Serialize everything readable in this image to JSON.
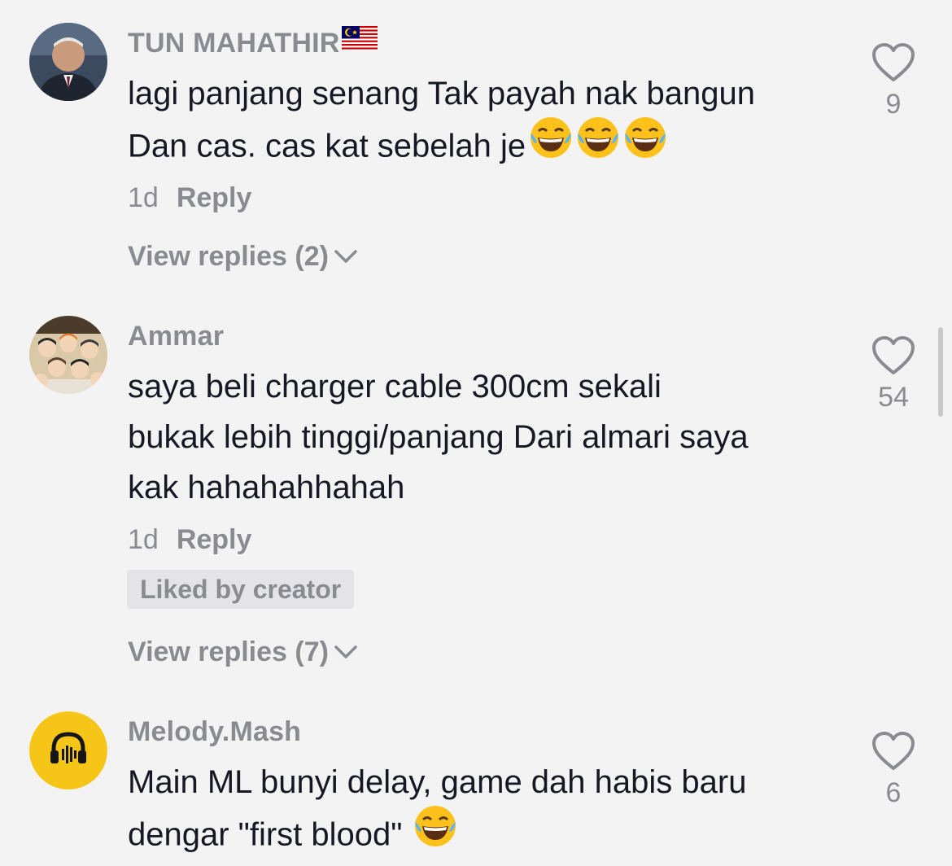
{
  "comments": [
    {
      "username": "TUN MAHATHIR",
      "username_flag": "malaysia-flag",
      "text": "lagi panjang senang Tak payah nak bangun\nDan cas. cas kat sebelah je",
      "text_emojis": [
        "face-with-tears-of-joy",
        "face-with-tears-of-joy",
        "face-with-tears-of-joy"
      ],
      "time": "1d",
      "reply_label": "Reply",
      "view_replies": "View replies (2)",
      "like_count": "9",
      "avatar": "portrait-avatar"
    },
    {
      "username": "Ammar",
      "text": "saya beli charger cable 300cm sekali\nbukak lebih tinggi/panjang Dari almari saya\nkak hahahahhahah",
      "time": "1d",
      "reply_label": "Reply",
      "badge": "Liked by creator",
      "view_replies": "View replies (7)",
      "like_count": "54",
      "avatar": "anime-group-avatar"
    },
    {
      "username": "Melody.Mash",
      "text": "Main ML bunyi delay, game dah habis baru\ndengar \"first blood\"",
      "text_emojis": [
        "face-with-tears-of-joy"
      ],
      "like_count": "6",
      "avatar": "headphones-avatar"
    }
  ],
  "colors": {
    "background": "#f3f3f4",
    "text_primary": "#161823",
    "text_secondary": "#8a8b91",
    "badge_bg": "#e4e4e6",
    "avatar_yellow": "#f5c518"
  },
  "icons": {
    "like": "heart-outline-icon",
    "expand": "chevron-down-icon"
  }
}
